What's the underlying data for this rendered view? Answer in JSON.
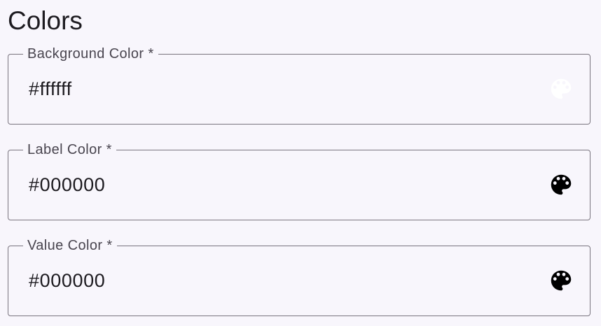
{
  "section": {
    "title": "Colors"
  },
  "fields": [
    {
      "label": "Background Color *",
      "value": "#ffffff",
      "icon": "palette-icon",
      "icon_color": "#ffffff"
    },
    {
      "label": "Label Color *",
      "value": "#000000",
      "icon": "palette-icon",
      "icon_color": "#000000"
    },
    {
      "label": "Value Color *",
      "value": "#000000",
      "icon": "palette-icon",
      "icon_color": "#000000"
    }
  ],
  "colors": {
    "background": "#f8f6fc",
    "outline": "#79747e",
    "label_text": "#49454f",
    "value_text": "#1d1b20"
  }
}
